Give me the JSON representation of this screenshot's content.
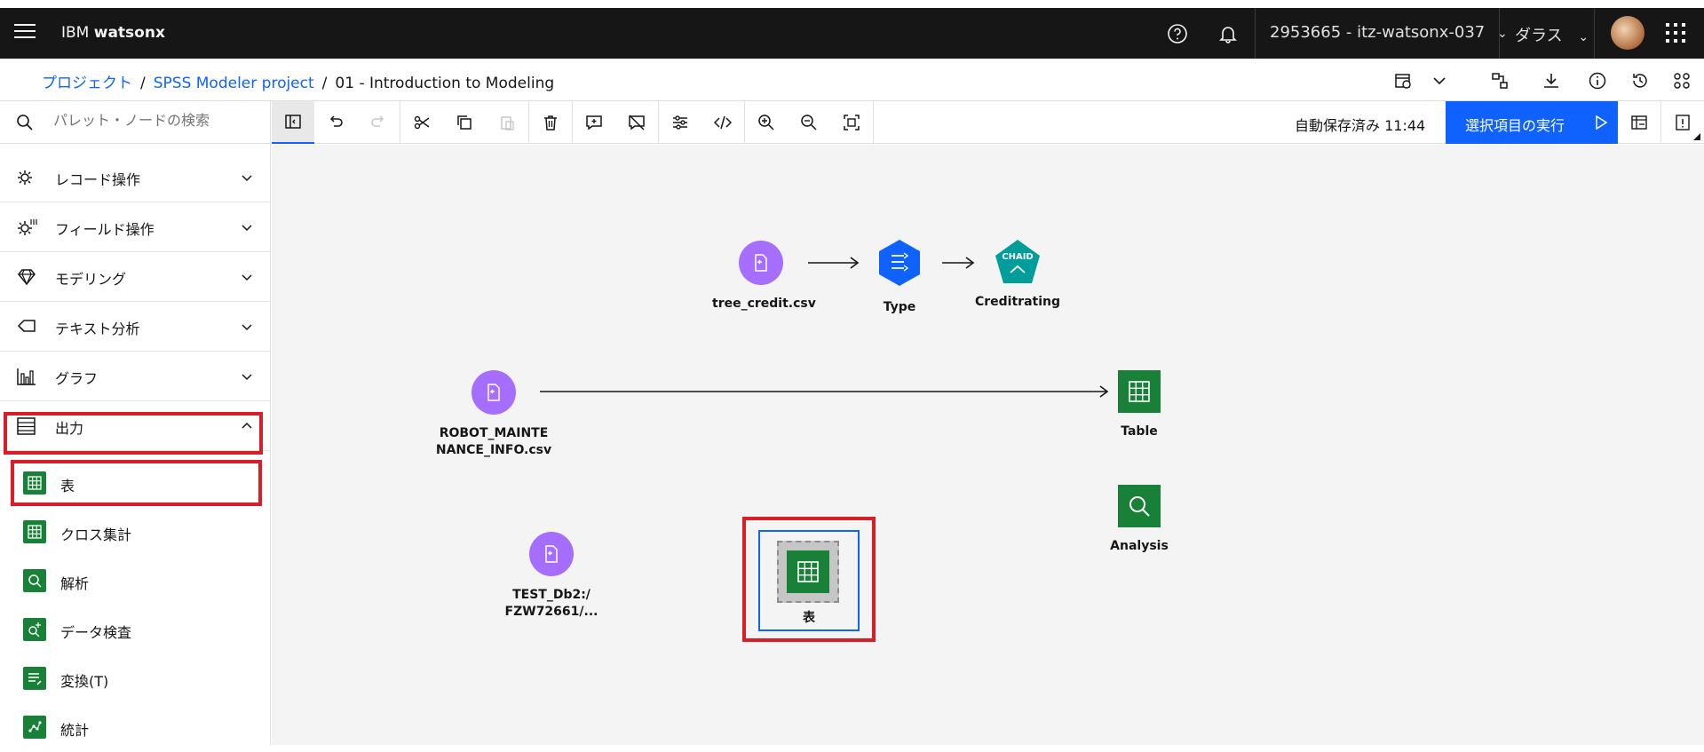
{
  "header": {
    "brand_prefix": "IBM",
    "brand_name": "watsonx",
    "account": "2953665 - itz-watsonx-037",
    "region": "ダラス"
  },
  "breadcrumb": {
    "items": [
      "プロジェクト",
      "SPSS Modeler project"
    ],
    "current": "01 - Introduction to Modeling",
    "separator": "/"
  },
  "palette": {
    "search_placeholder": "パレット・ノードの検索",
    "categories": [
      {
        "label": "レコード操作",
        "icon": "record-ops-icon"
      },
      {
        "label": "フィールド操作",
        "icon": "field-ops-icon"
      },
      {
        "label": "モデリング",
        "icon": "diamond-icon"
      },
      {
        "label": "テキスト分析",
        "icon": "text-analysis-icon"
      },
      {
        "label": "グラフ",
        "icon": "bar-chart-icon"
      },
      {
        "label": "出力",
        "icon": "output-icon"
      }
    ],
    "output_items": [
      {
        "label": "表",
        "icon": "table-icon"
      },
      {
        "label": "クロス集計",
        "icon": "matrix-icon"
      },
      {
        "label": "解析",
        "icon": "search-icon"
      },
      {
        "label": "データ検査",
        "icon": "data-audit-icon"
      },
      {
        "label": "変換(T)",
        "icon": "transform-icon"
      },
      {
        "label": "統計",
        "icon": "statistics-icon"
      }
    ]
  },
  "toolbar": {
    "autosave": "自動保存済み 11:44",
    "run_label": "選択項目の実行"
  },
  "canvas": {
    "nodes": {
      "tree_credit": "tree_credit.csv",
      "type": "Type",
      "chaid_badge": "CHAID",
      "creditrating": "Creditrating",
      "robot_line1": "ROBOT_MAINTE",
      "robot_line2": "NANCE_INFO.csv",
      "table": "Table",
      "analysis": "Analysis",
      "test_line1": "TEST_Db2:/",
      "test_line2": "FZW72661/...",
      "new_table": "表"
    }
  },
  "colors": {
    "accent": "#0f62fe",
    "highlight": "#da1e28",
    "source_node": "#a56eff",
    "output_node": "#198038",
    "type_node": "#0f62fe",
    "model_node": "#009d9a"
  }
}
